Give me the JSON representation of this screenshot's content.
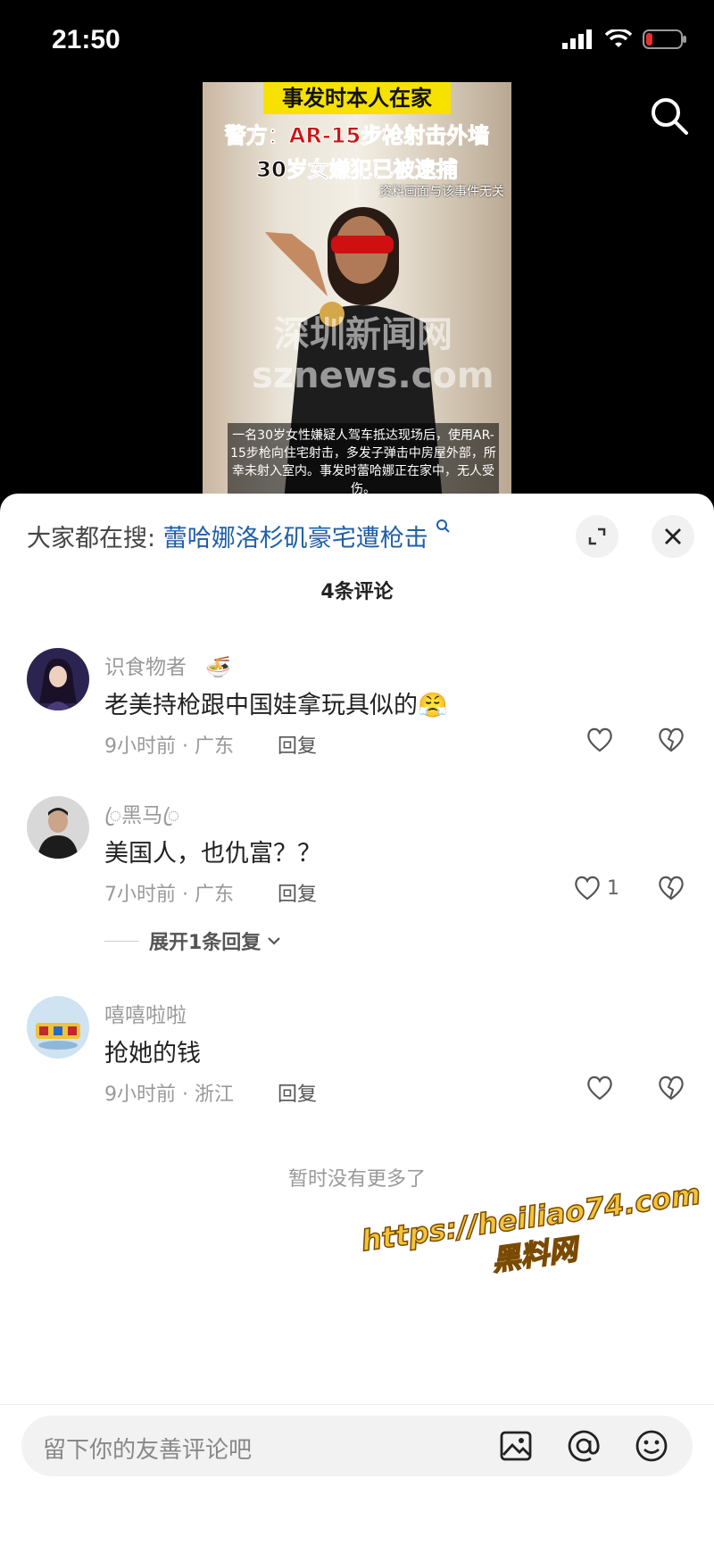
{
  "status_bar": {
    "time": "21:50"
  },
  "video": {
    "caption_yellow": "事发时本人在家",
    "caption_red": "警方：AR-15步枪射击外墙",
    "caption_black": "30岁女嫌犯已被逮捕",
    "caption_note": "资料画面与该事件无关",
    "watermark_cn": "深圳新闻网",
    "watermark_en": "sznews.com",
    "description": "一名30岁女性嫌疑人驾车抵达现场后，使用AR-15步枪向住宅射击，多发子弹击中房屋外部，所幸未射入室内。事发时蕾哈娜正在家中，无人受伤。"
  },
  "comments_sheet": {
    "trending_prefix": "大家都在搜:",
    "trending_query": "蕾哈娜洛杉矶豪宅遭枪击",
    "comment_count": "4条评论",
    "comments": [
      {
        "username": "识食物者",
        "badge": "🍜",
        "text": "老美持枪跟中国娃拿玩具似的😤",
        "meta": "9小时前 · 广东",
        "reply_label": "回复",
        "likes": ""
      },
      {
        "username": "ꦿ黑马ꦿ",
        "text": "美国人，也仇富？？",
        "meta": "7小时前 · 广东",
        "reply_label": "回复",
        "likes": "1",
        "expand_replies": "展开1条回复"
      },
      {
        "username": "嘻嘻啦啦",
        "text": "抢她的钱",
        "meta": "9小时前 · 浙江",
        "reply_label": "回复",
        "likes": ""
      }
    ],
    "no_more": "暂时没有更多了",
    "watermark_url": "https://heiliao74.com",
    "watermark_name": "黑料网",
    "input_placeholder": "留下你的友善评论吧"
  },
  "colors": {
    "link": "#1f5fa8",
    "sheet_bg": "#ffffff",
    "page_bg": "#000000"
  }
}
